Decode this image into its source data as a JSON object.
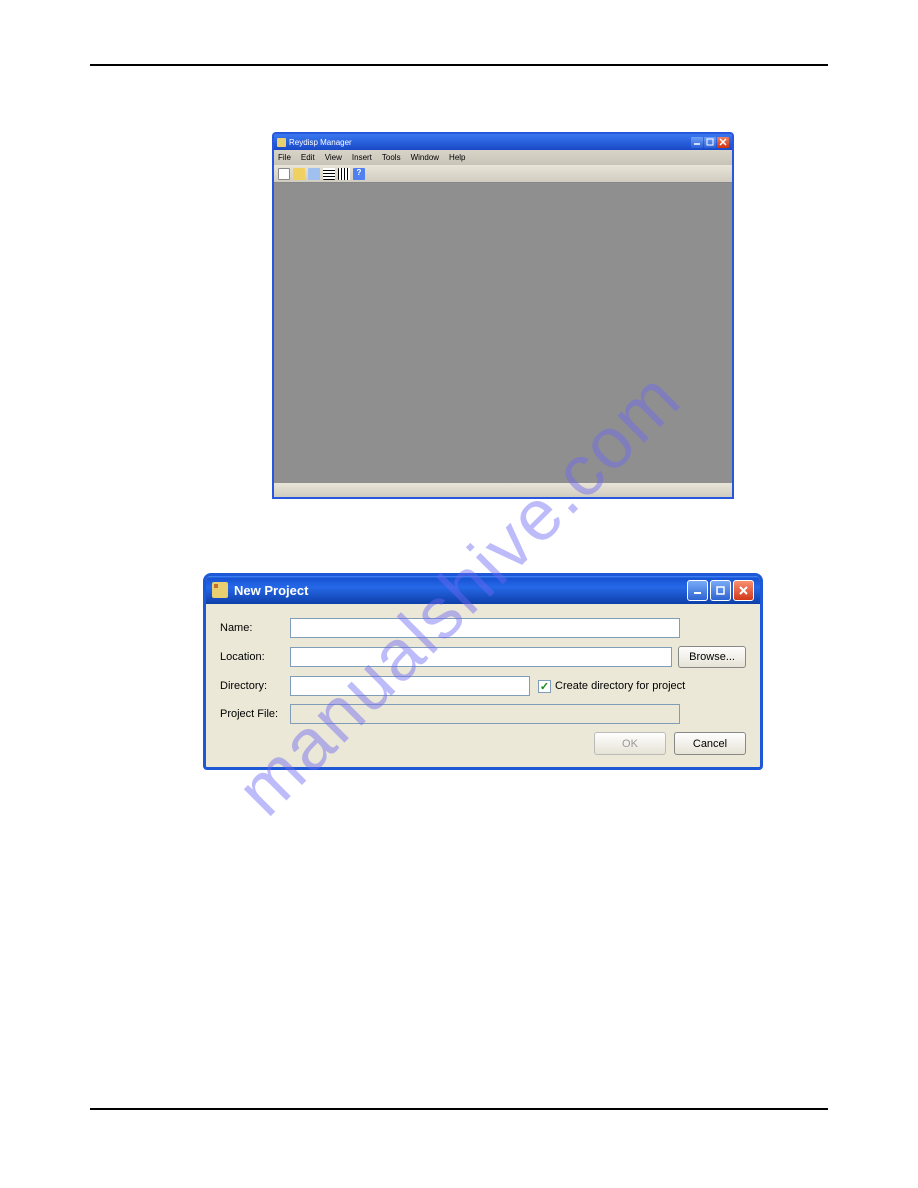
{
  "watermark": "manualshive.com",
  "window1": {
    "title": "Reydisp Manager",
    "menus": [
      "File",
      "Edit",
      "View",
      "Insert",
      "Tools",
      "Window",
      "Help"
    ],
    "help_glyph": "?"
  },
  "window2": {
    "title": "New Project",
    "fields": {
      "name_label": "Name:",
      "location_label": "Location:",
      "directory_label": "Directory:",
      "projectfile_label": "Project File:",
      "browse": "Browse...",
      "create_dir": "Create directory for project",
      "ok": "OK",
      "cancel": "Cancel"
    },
    "values": {
      "name": "",
      "location": "",
      "directory": "",
      "projectfile": ""
    }
  }
}
